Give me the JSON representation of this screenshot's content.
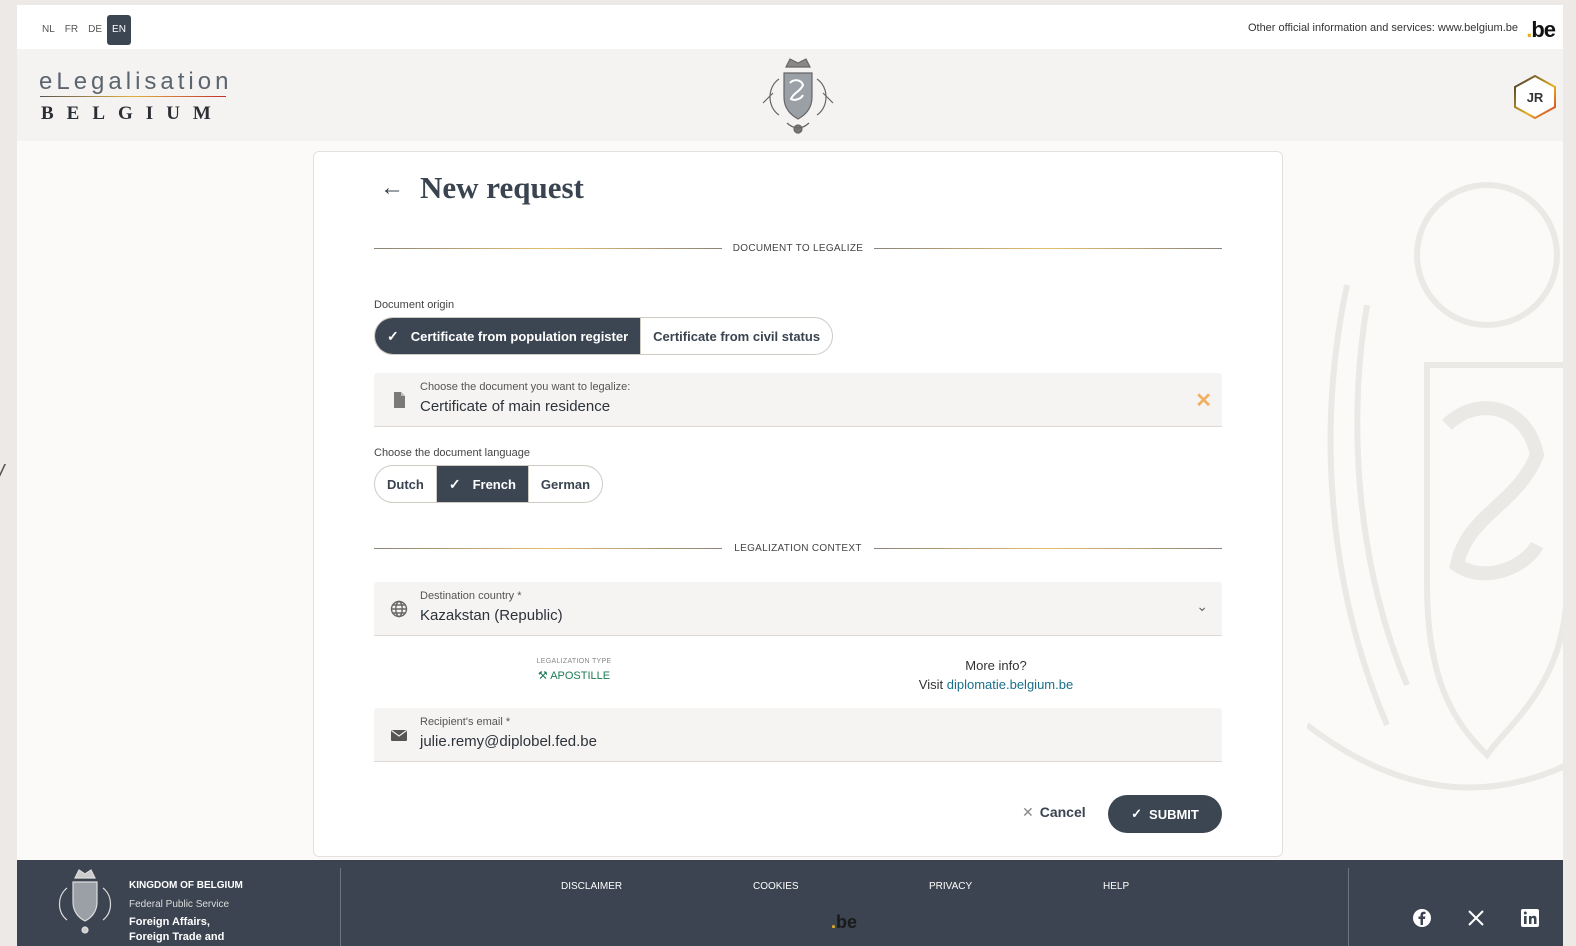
{
  "topbar": {
    "languages": [
      {
        "code": "NL",
        "active": false
      },
      {
        "code": "FR",
        "active": false
      },
      {
        "code": "DE",
        "active": false
      },
      {
        "code": "EN",
        "active": true
      }
    ],
    "official_text": "Other official information and services: www.belgium.be",
    "be_logo": "be"
  },
  "header": {
    "brand_top": "eLegalisation",
    "brand_bottom": "BELGIUM",
    "avatar_initials": "JR"
  },
  "form": {
    "title": "New request",
    "section_document": "DOCUMENT TO LEGALIZE",
    "origin_label": "Document origin",
    "origin_options": [
      {
        "label": "Certificate from population register",
        "selected": true
      },
      {
        "label": "Certificate from civil status",
        "selected": false
      }
    ],
    "document_field": {
      "label": "Choose the document you want to legalize:",
      "value": "Certificate of main residence"
    },
    "language_label": "Choose the document language",
    "language_options": [
      {
        "label": "Dutch",
        "selected": false
      },
      {
        "label": "French",
        "selected": true
      },
      {
        "label": "German",
        "selected": false
      }
    ],
    "section_context": "LEGALIZATION CONTEXT",
    "country_field": {
      "label": "Destination country *",
      "value": "Kazakstan (Republic)"
    },
    "legalization_type_caption": "LEGALIZATION TYPE",
    "legalization_type_value": "APOSTILLE",
    "more_info": "More info?",
    "visit_text": "Visit",
    "visit_link": "diplomatie.belgium.be",
    "email_field": {
      "label": "Recipient's email *",
      "value": "julie.remy@diplobel.fed.be"
    },
    "cancel_label": "Cancel",
    "submit_label": "SUBMIT"
  },
  "footer": {
    "kingdom": "KINGDOM OF BELGIUM",
    "service": "Federal Public Service",
    "affairs_line1": "Foreign Affairs,",
    "affairs_line2": "Foreign Trade and",
    "links": [
      "DISCLAIMER",
      "COOKIES",
      "PRIVACY",
      "HELP"
    ],
    "be_logo": "be",
    "social": [
      "facebook-icon",
      "x-icon",
      "linkedin-icon"
    ]
  },
  "colors": {
    "primary": "#3c4652",
    "apostille": "#1d7a55",
    "link": "#1a6f8a",
    "clear": "#f0b060"
  }
}
